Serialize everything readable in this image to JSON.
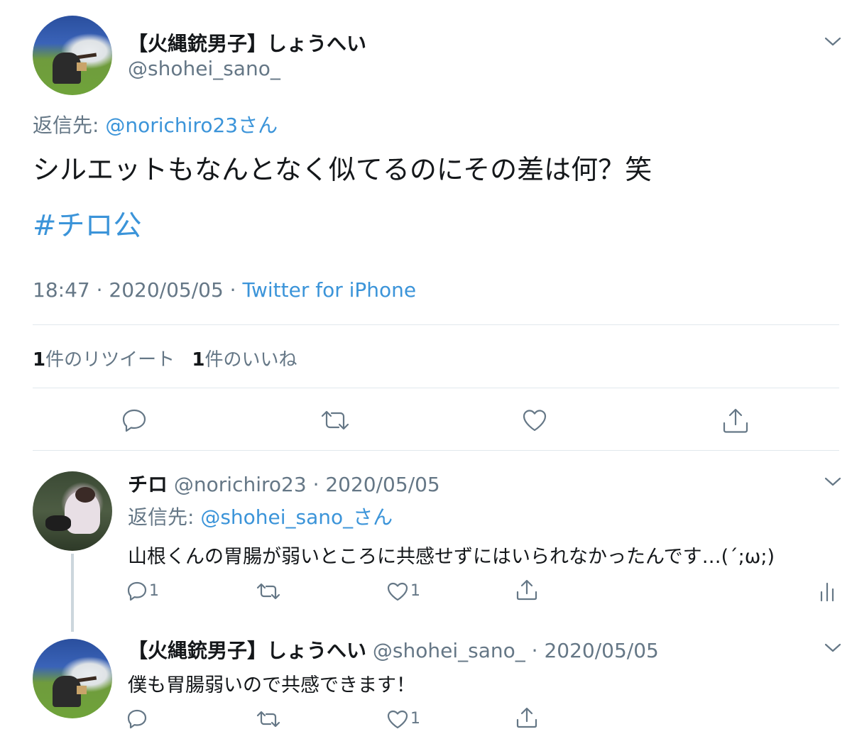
{
  "main_tweet": {
    "display_name": "【火縄銃男子】しょうへい",
    "handle": "@shohei_sano_",
    "reply_to_prefix": "返信先: ",
    "reply_to_handle": "@norichiro23さん",
    "text": "シルエットもなんとなく似てるのにその差は何？笑",
    "hashtag": "#チロ公",
    "timestamp": "18:47 · 2020/05/05 · ",
    "source": "Twitter for iPhone",
    "retweet_count": "1",
    "retweet_label": "件のリツイート",
    "like_count": "1",
    "like_label": "件のいいね"
  },
  "replies": [
    {
      "display_name": "チロ",
      "handle_date": "@norichiro23 · 2020/05/05",
      "reply_to_prefix": "返信先: ",
      "reply_to_handle": "@shohei_sano_さん",
      "text": "山根くんの胃腸が弱いところに共感せずにはいられなかったんです…(´;ω;)",
      "reply_count": "1",
      "like_count": "1"
    },
    {
      "display_name": "【火縄銃男子】しょうへい",
      "handle_date": "@shohei_sano_ · 2020/05/05",
      "text": "僕も胃腸弱いので共感できます！",
      "like_count": "1"
    }
  ],
  "colors": {
    "link": "#3b94d9",
    "muted": "#657786",
    "divider": "#e1e8ed"
  },
  "icons": [
    "reply-icon",
    "retweet-icon",
    "like-icon",
    "share-icon",
    "chevron-down-icon",
    "analytics-icon"
  ]
}
